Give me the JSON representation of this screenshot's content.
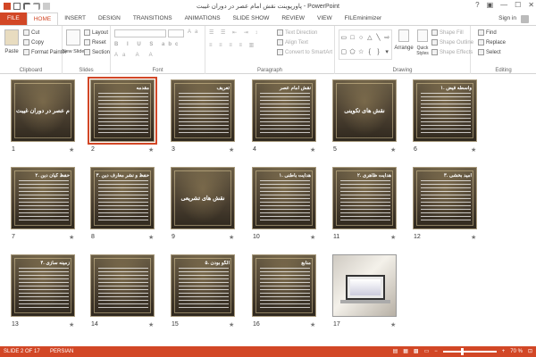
{
  "window": {
    "title": "پاورپوینت نقش امام عصر در دوران غیبت - PowerPoint"
  },
  "tabs": [
    "FILE",
    "HOME",
    "INSERT",
    "DESIGN",
    "TRANSITIONS",
    "ANIMATIONS",
    "SLIDE SHOW",
    "REVIEW",
    "VIEW",
    "FILEminimizer"
  ],
  "account": {
    "signin": "Sign in"
  },
  "ribbon": {
    "clipboard": {
      "paste": "Paste",
      "cut": "Cut",
      "copy": "Copy",
      "format_painter": "Format Painter",
      "label": "Clipboard"
    },
    "slides": {
      "new_slide": "New Slide",
      "layout": "Layout",
      "reset": "Reset",
      "section": "Section",
      "label": "Slides"
    },
    "font": {
      "label": "Font"
    },
    "paragraph": {
      "text_direction": "Text Direction",
      "align_text": "Align Text",
      "smartart": "Convert to SmartArt",
      "label": "Paragraph"
    },
    "drawing": {
      "arrange": "Arrange",
      "quick_styles": "Quick Styles",
      "shape_fill": "Shape Fill",
      "shape_outline": "Shape Outline",
      "shape_effects": "Shape Effects",
      "label": "Drawing"
    },
    "editing": {
      "find": "Find",
      "replace": "Replace",
      "select": "Select",
      "label": "Editing"
    }
  },
  "slides": [
    {
      "num": "1",
      "title": "نقش امام عصر در دوران غیبت",
      "kind": "title"
    },
    {
      "num": "2",
      "title": "مقدمه",
      "kind": "text"
    },
    {
      "num": "3",
      "title": "تعریف",
      "kind": "text"
    },
    {
      "num": "4",
      "title": "نقش امام عصر",
      "kind": "text"
    },
    {
      "num": "5",
      "title": "نقش های تکوینی",
      "kind": "title"
    },
    {
      "num": "6",
      "title": "۱. واسطه فیض",
      "kind": "text"
    },
    {
      "num": "7",
      "title": "۲. حفظ کیان دین",
      "kind": "text"
    },
    {
      "num": "8",
      "title": "۳. حفظ و نشر معارف دین",
      "kind": "text"
    },
    {
      "num": "9",
      "title": "نقش های تشریعی",
      "kind": "title"
    },
    {
      "num": "10",
      "title": "۱. هدایت باطنی",
      "kind": "text"
    },
    {
      "num": "11",
      "title": "۲. هدایت ظاهری",
      "kind": "text"
    },
    {
      "num": "12",
      "title": "۳. امید بخشی",
      "kind": "text"
    },
    {
      "num": "13",
      "title": "۴. زمینه سازی",
      "kind": "text"
    },
    {
      "num": "14",
      "title": "",
      "kind": "text"
    },
    {
      "num": "15",
      "title": "۵. الگو بودن",
      "kind": "text"
    },
    {
      "num": "16",
      "title": "منابع",
      "kind": "text"
    },
    {
      "num": "17",
      "title": "",
      "kind": "photo"
    }
  ],
  "status": {
    "slide_info": "SLIDE 2 OF 17",
    "language": "PERSIAN",
    "zoom": "70 %"
  }
}
